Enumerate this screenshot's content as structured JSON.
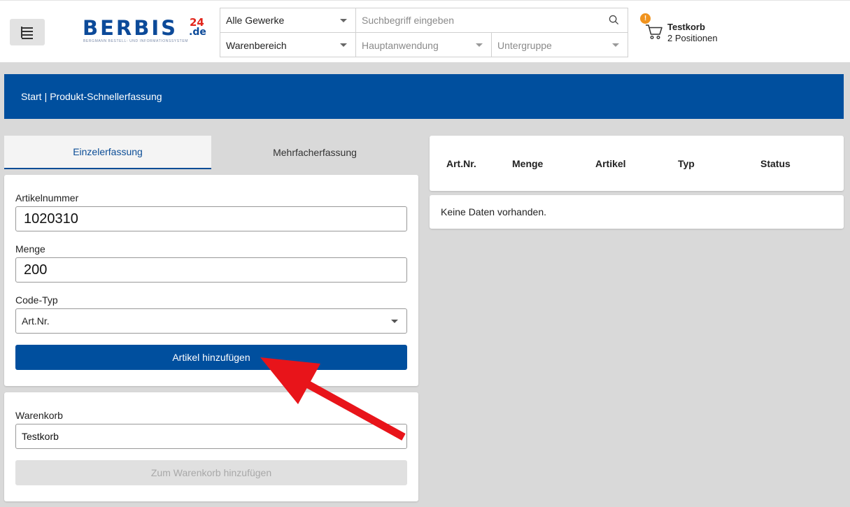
{
  "header": {
    "logo": {
      "brand": "BERBIS",
      "number": "24",
      "tld": ".de",
      "tagline": "BERGMANN BESTELL- UND INFORMATIONSSYSTEM"
    },
    "search": {
      "gewerke_value": "Alle Gewerke",
      "search_placeholder": "Suchbegriff eingeben",
      "warenbereich_value": "Warenbereich",
      "hauptanwendung_placeholder": "Hauptanwendung",
      "untergruppe_placeholder": "Untergruppe"
    },
    "cart": {
      "badge": "!",
      "name": "Testkorb",
      "positions": "2 Positionen"
    }
  },
  "breadcrumb": {
    "home": "Start",
    "separator": "|",
    "current": "Produkt-Schnellerfassung"
  },
  "tabs": [
    {
      "label": "Einzelerfassung",
      "active": true
    },
    {
      "label": "Mehrfacherfassung",
      "active": false
    }
  ],
  "form": {
    "artikelnummer_label": "Artikelnummer",
    "artikelnummer_value": "1020310",
    "menge_label": "Menge",
    "menge_value": "200",
    "codetyp_label": "Code-Typ",
    "codetyp_value": "Art.Nr.",
    "add_button": "Artikel hinzufügen"
  },
  "cart_form": {
    "warenkorb_label": "Warenkorb",
    "warenkorb_value": "Testkorb",
    "add_to_cart_button": "Zum Warenkorb hinzufügen"
  },
  "table": {
    "columns": [
      "Art.Nr.",
      "Menge",
      "Artikel",
      "Typ",
      "Status"
    ],
    "empty_text": "Keine Daten vorhanden."
  },
  "colors": {
    "brand_blue": "#004f9e",
    "badge_orange": "#f0931e",
    "annotation_red": "#e8141a"
  }
}
